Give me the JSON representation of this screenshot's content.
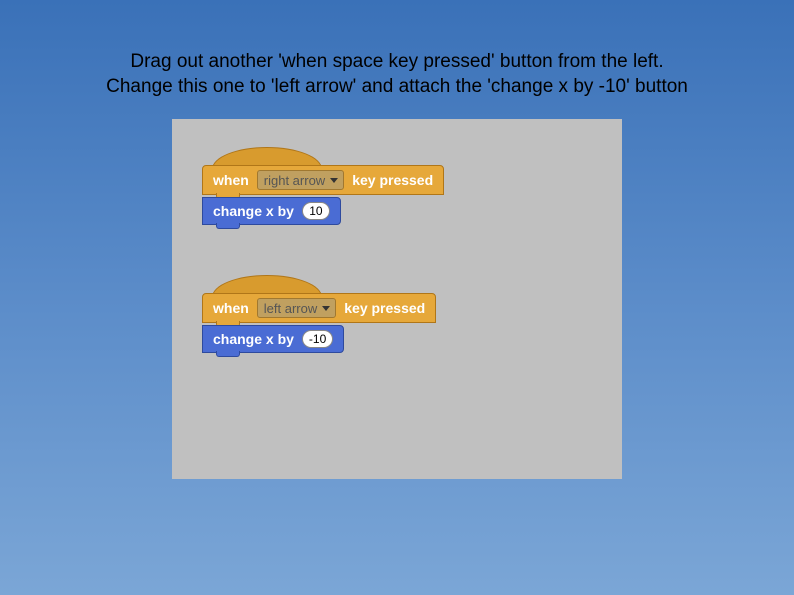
{
  "instruction": {
    "line1": "Drag out another 'when space key pressed' button from the left.",
    "line2": "Change this one to 'left arrow' and attach the 'change x by -10' button"
  },
  "scripts": [
    {
      "hat": {
        "prefix": "when",
        "dropdown": "right arrow",
        "suffix": "key pressed"
      },
      "stack": {
        "label": "change x by",
        "value": "10"
      }
    },
    {
      "hat": {
        "prefix": "when",
        "dropdown": "left arrow",
        "suffix": "key pressed"
      },
      "stack": {
        "label": "change x by",
        "value": "-10"
      }
    }
  ]
}
